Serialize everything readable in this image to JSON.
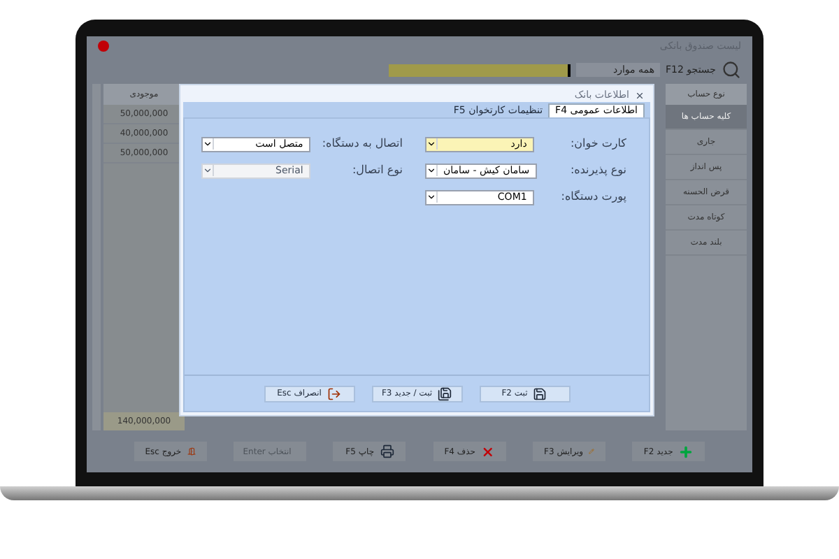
{
  "window": {
    "title": "لیست صندوق بانکی"
  },
  "search": {
    "label": "جستجو F12",
    "filter": "همه موارد"
  },
  "accounts": {
    "column": "نوع حساب",
    "items": [
      {
        "label": "کلیه حساب ها",
        "selected": true
      },
      {
        "label": "جاری",
        "selected": false
      },
      {
        "label": "پس انداز",
        "selected": false
      },
      {
        "label": "قرض الحسنه",
        "selected": false
      },
      {
        "label": "کوتاه مدت",
        "selected": false
      },
      {
        "label": "بلند مدت",
        "selected": false
      }
    ]
  },
  "balances": {
    "column": "موجودی",
    "rows": [
      "50,000,000",
      "40,000,000",
      "50,000,000"
    ],
    "total": "140,000,000"
  },
  "toolbar": [
    {
      "label": "جدید F2",
      "disabled": false
    },
    {
      "label": "ویرایش F3",
      "disabled": false
    },
    {
      "label": "حذف F4",
      "disabled": false
    },
    {
      "label": "چاپ F5",
      "disabled": false
    },
    {
      "label": "انتخاب Enter",
      "disabled": true
    },
    {
      "label": "خروج Esc",
      "disabled": false
    }
  ],
  "dialog": {
    "title": "اطلاعات بانک",
    "tabs": [
      {
        "label": "اطلاعات عمومی F4",
        "selected": true
      },
      {
        "label": "تنظیمات کارتخوان F5",
        "selected": false
      }
    ],
    "fields": [
      {
        "label": "کارت خوان:",
        "value": "دارد",
        "disabled": false,
        "focused": true
      },
      {
        "label": "اتصال به دستگاه:",
        "value": "متصل است",
        "disabled": false,
        "focused": false
      },
      {
        "label": "نوع پذیرنده:",
        "value": "سامان کیش - سامان",
        "disabled": false,
        "focused": false
      },
      {
        "label": "نوع اتصال:",
        "value": "Serial",
        "disabled": true,
        "focused": false
      },
      {
        "label": "پورت دستگاه:",
        "value": "COM1",
        "disabled": false,
        "focused": false
      }
    ],
    "buttons": [
      "ثبت F2",
      "ثبت / جدید F3",
      "انصراف Esc"
    ]
  }
}
